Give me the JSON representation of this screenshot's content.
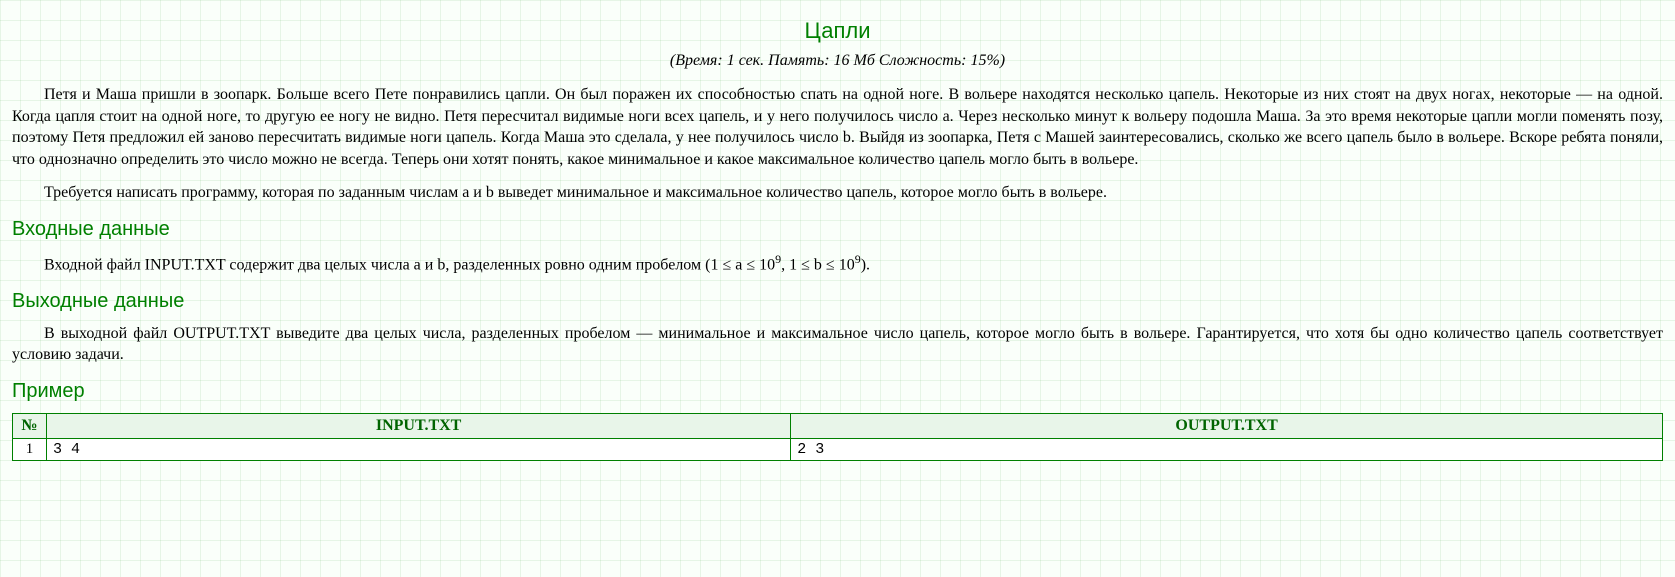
{
  "title": "Цапли",
  "meta": "(Время: 1 сек. Память: 16 Мб Сложность: 15%)",
  "p1": "Петя и Маша пришли в зоопарк. Больше всего Пете понравились цапли. Он был поражен их способностью спать на одной ноге. В вольере находятся несколько цапель. Некоторые из них стоят на двух ногах, некоторые — на одной. Когда цапля стоит на одной ноге, то другую ее ногу не видно. Петя пересчитал видимые ноги всех цапель, и у него получилось число a. Через несколько минут к вольеру подошла Маша. За это время некоторые цапли могли поменять позу, поэтому Петя предложил ей заново пересчитать видимые ноги цапель. Когда Маша это сделала, у нее получилось число b. Выйдя из зоопарка, Петя с Машей заинтересовались, сколько же всего цапель было в вольере. Вскоре ребята поняли, что однозначно определить это число можно не всегда. Теперь они хотят понять, какое минимальное и какое максимальное количество цапель могло быть в вольере.",
  "p2": "Требуется написать программу, которая по заданным числам a и b выведет минимальное и максимальное количество цапель, которое могло быть в вольере.",
  "h_input": "Входные данные",
  "input_pre": "Входной файл INPUT.TXT содержит два целых числа a и b, разделенных ровно одним пробелом (1 ≤ a ≤ 10",
  "input_mid": ", 1 ≤ b ≤ 10",
  "input_post": ").",
  "input_exp": "9",
  "h_output": "Выходные данные",
  "output_text": "В выходной файл OUTPUT.TXT выведите два целых числа, разделенных пробелом — минимальное и максимальное число цапель, которое могло быть в вольере. Гарантируется, что хотя бы одно количество цапель соответствует условию задачи.",
  "h_example": "Пример",
  "table": {
    "h_num": "№",
    "h_in": "INPUT.TXT",
    "h_out": "OUTPUT.TXT",
    "rows": [
      {
        "n": "1",
        "in": "3 4",
        "out": "2 3"
      }
    ]
  }
}
